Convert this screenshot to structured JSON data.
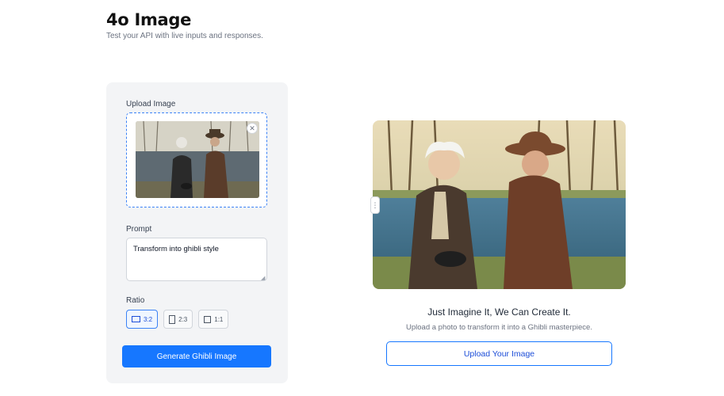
{
  "header": {
    "title": "4o Image",
    "subtitle": "Test your API with live inputs and responses."
  },
  "form": {
    "upload_label": "Upload Image",
    "remove_icon": "close-icon",
    "prompt_label": "Prompt",
    "prompt_value": "Transform into ghibli style",
    "ratio_label": "Ratio",
    "ratios": [
      {
        "label": "3:2",
        "icon": "landscape-image-icon",
        "selected": true
      },
      {
        "label": "2:3",
        "icon": "portrait-image-icon",
        "selected": false
      },
      {
        "label": "1:1",
        "icon": "square-icon",
        "selected": false
      }
    ],
    "generate_label": "Generate Ghibli Image"
  },
  "preview": {
    "headline": "Just Imagine It, We Can Create It.",
    "tagline": "Upload a photo to transform it into a Ghibli masterpiece.",
    "upload_button": "Upload Your Image",
    "compare_handle_icon": "drag-handle-icon"
  },
  "colors": {
    "accent": "#1677ff",
    "panel_bg": "#f3f4f6",
    "dropzone_border": "#3b82f6"
  }
}
